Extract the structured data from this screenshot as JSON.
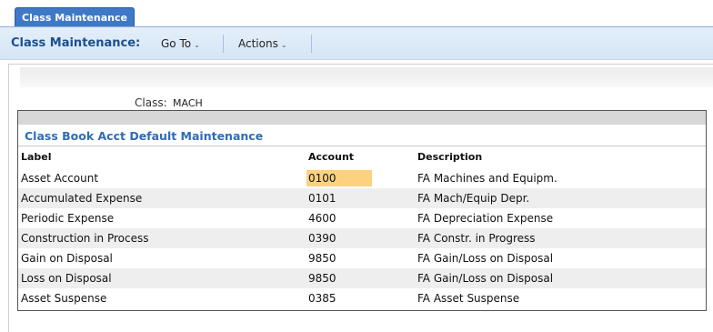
{
  "tab": {
    "label": "Class Maintenance"
  },
  "toolbar": {
    "title": "Class Maintenance:",
    "goto_label": "Go To",
    "actions_label": "Actions"
  },
  "class_field": {
    "label": "Class:",
    "value": "MACH"
  },
  "grid": {
    "title": "Class Book Acct Default Maintenance",
    "columns": [
      "Label",
      "Account",
      "Description"
    ],
    "rows": [
      {
        "label": "Asset Account",
        "account": "0100",
        "description": "FA Machines and Equipm."
      },
      {
        "label": "Accumulated Expense",
        "account": "0101",
        "description": "FA Mach/Equip Depr."
      },
      {
        "label": "Periodic Expense",
        "account": "4600",
        "description": "FA Depreciation Expense"
      },
      {
        "label": "Construction in Process",
        "account": "0390",
        "description": "FA Constr. in Progress"
      },
      {
        "label": "Gain on Disposal",
        "account": "9850",
        "description": "FA Gain/Loss on Disposal"
      },
      {
        "label": "Loss on Disposal",
        "account": "9850",
        "description": "FA Gain/Loss on Disposal"
      },
      {
        "label": "Asset Suspense",
        "account": "0385",
        "description": "FA Asset Suspense"
      }
    ]
  },
  "colors": {
    "tab_bg": "#3f78c7",
    "toolbar_title": "#1c4f8c",
    "grid_title": "#2f6db5",
    "account_highlight": "#fcd27f",
    "alt_row": "#eeeeee"
  }
}
